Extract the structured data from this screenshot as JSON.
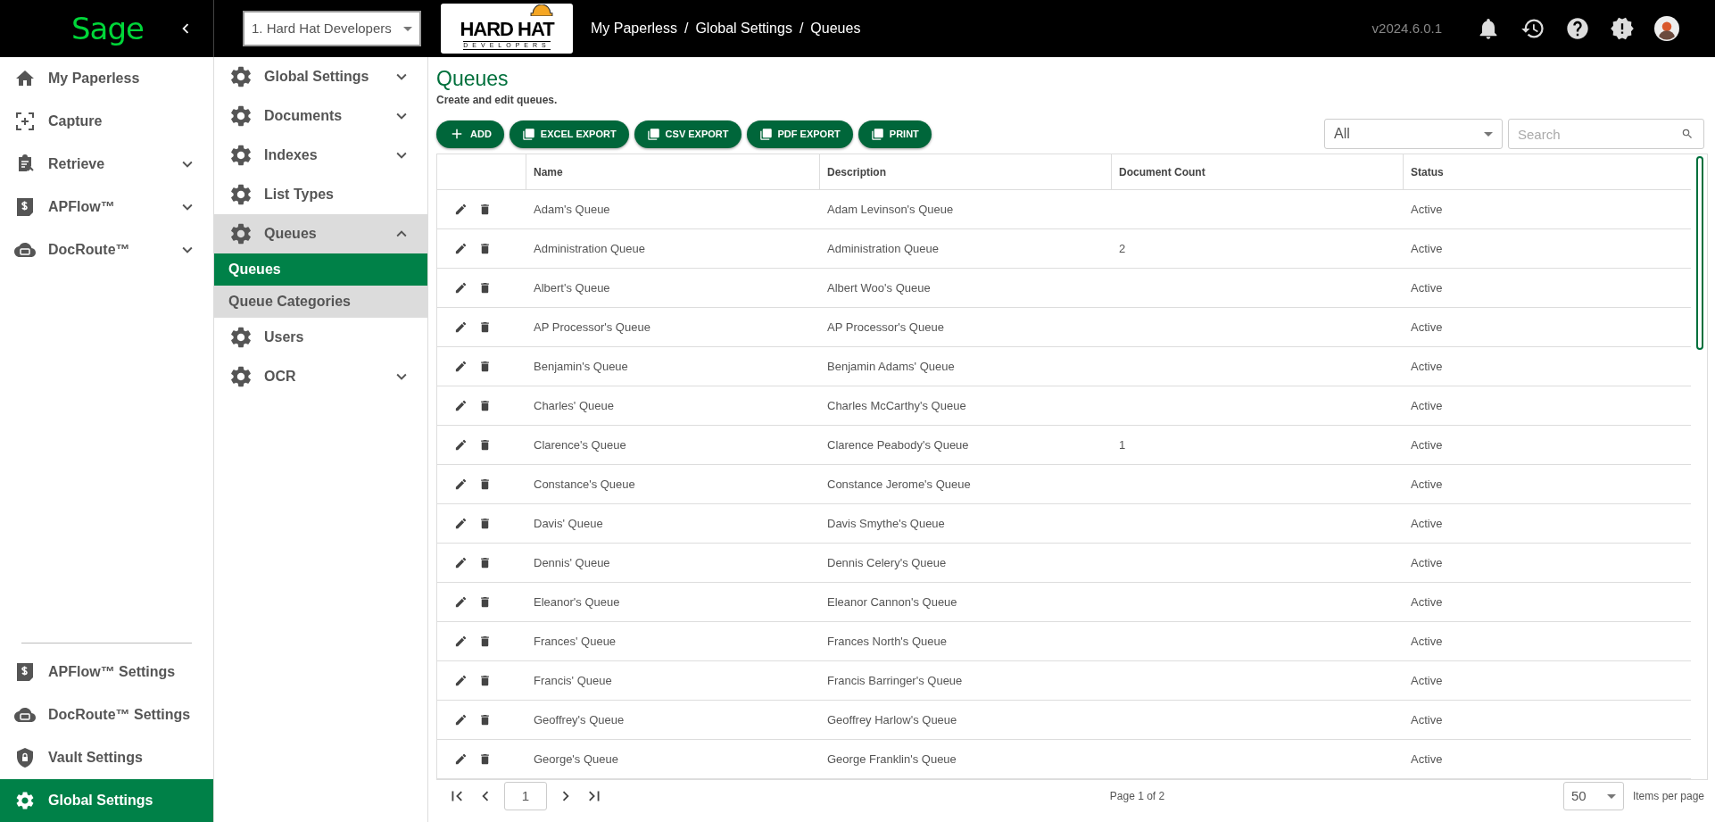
{
  "top_bar": {
    "logo": "Sage",
    "company_select": {
      "value": "1. Hard Hat Developers"
    },
    "company_logo": {
      "title": "HARD HAT",
      "subtitle": "DEVELOPERS"
    },
    "breadcrumb": [
      "My Paperless",
      "Global Settings",
      "Queues"
    ],
    "breadcrumb_separator": "/",
    "version": "v2024.6.0.1"
  },
  "main_nav": {
    "items": [
      {
        "label": "My Paperless",
        "selected": false
      },
      {
        "label": "Capture",
        "selected": false
      },
      {
        "label": "Retrieve",
        "expanded": false,
        "selected": false
      },
      {
        "label": "APFlow™",
        "expanded": false,
        "selected": false
      },
      {
        "label": "DocRoute™",
        "expanded": false,
        "selected": false
      }
    ],
    "bottom_items": [
      {
        "label": "APFlow™ Settings",
        "selected": false
      },
      {
        "label": "DocRoute™ Settings",
        "selected": false
      },
      {
        "label": "Vault Settings",
        "selected": false
      },
      {
        "label": "Global Settings",
        "selected": true
      }
    ]
  },
  "settings_nav": [
    {
      "label": "Global Settings",
      "expanded": false
    },
    {
      "label": "Documents",
      "expanded": false
    },
    {
      "label": "Indexes",
      "expanded": false
    },
    {
      "label": "List Types"
    },
    {
      "label": "Queues",
      "expanded": true,
      "children": [
        {
          "label": "Queues",
          "selected": true
        },
        {
          "label": "Queue Categories",
          "selected": false
        }
      ]
    },
    {
      "label": "Users"
    },
    {
      "label": "OCR",
      "expanded": false
    }
  ],
  "page": {
    "title": "Queues",
    "subtitle": "Create and edit queues."
  },
  "toolbar": {
    "buttons": [
      {
        "label": "ADD",
        "kind": "add"
      },
      {
        "label": "EXCEL EXPORT",
        "kind": "export"
      },
      {
        "label": "CSV EXPORT",
        "kind": "export"
      },
      {
        "label": "PDF EXPORT",
        "kind": "export"
      },
      {
        "label": "PRINT",
        "kind": "export"
      }
    ],
    "filter": {
      "value": "All"
    },
    "search": {
      "placeholder": "Search"
    }
  },
  "table": {
    "columns": [
      "Name",
      "Description",
      "Document Count",
      "Status"
    ],
    "rows": [
      {
        "name": "Adam's Queue",
        "description": "Adam Levinson's Queue",
        "document_count": "",
        "status": "Active"
      },
      {
        "name": "Administration Queue",
        "description": "Administration Queue",
        "document_count": "2",
        "status": "Active"
      },
      {
        "name": "Albert's Queue",
        "description": "Albert Woo's Queue",
        "document_count": "",
        "status": "Active"
      },
      {
        "name": "AP Processor's Queue",
        "description": "AP Processor's Queue",
        "document_count": "",
        "status": "Active"
      },
      {
        "name": "Benjamin's Queue",
        "description": "Benjamin Adams' Queue",
        "document_count": "",
        "status": "Active"
      },
      {
        "name": "Charles' Queue",
        "description": "Charles McCarthy's Queue",
        "document_count": "",
        "status": "Active"
      },
      {
        "name": "Clarence's Queue",
        "description": "Clarence Peabody's Queue",
        "document_count": "1",
        "status": "Active"
      },
      {
        "name": "Constance's Queue",
        "description": "Constance Jerome's Queue",
        "document_count": "",
        "status": "Active"
      },
      {
        "name": "Davis' Queue",
        "description": "Davis Smythe's Queue",
        "document_count": "",
        "status": "Active"
      },
      {
        "name": "Dennis' Queue",
        "description": "Dennis Celery's Queue",
        "document_count": "",
        "status": "Active"
      },
      {
        "name": "Eleanor's Queue",
        "description": "Eleanor Cannon's Queue",
        "document_count": "",
        "status": "Active"
      },
      {
        "name": "Frances' Queue",
        "description": "Frances North's Queue",
        "document_count": "",
        "status": "Active"
      },
      {
        "name": "Francis' Queue",
        "description": "Francis Barringer's Queue",
        "document_count": "",
        "status": "Active"
      },
      {
        "name": "Geoffrey's Queue",
        "description": "Geoffrey Harlow's Queue",
        "document_count": "",
        "status": "Active"
      },
      {
        "name": "George's Queue",
        "description": "George Franklin's Queue",
        "document_count": "",
        "status": "Active"
      }
    ]
  },
  "pagination": {
    "page": "1",
    "summary": "Page 1 of 2",
    "page_size": "50",
    "page_size_label": "Items per page"
  }
}
